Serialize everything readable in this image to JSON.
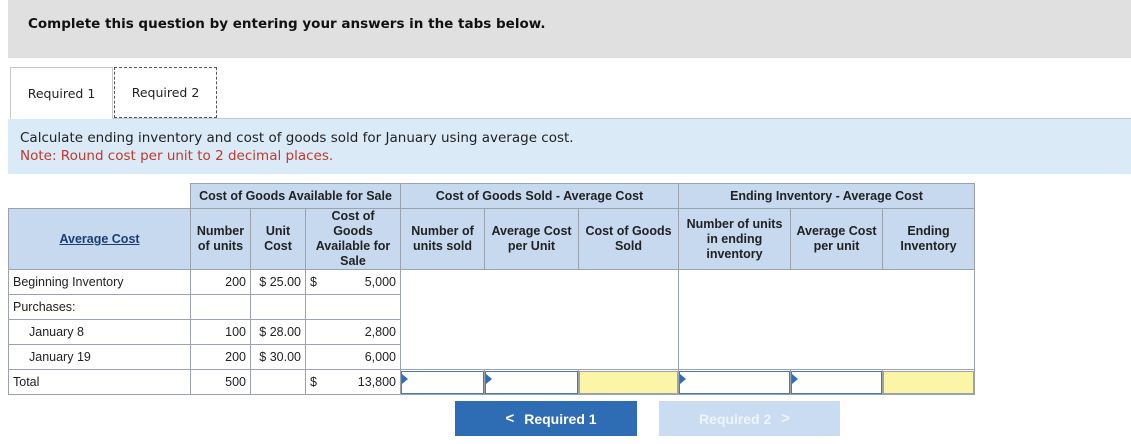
{
  "header": {
    "title": "Complete this question by entering your answers in the tabs below."
  },
  "tabs": [
    {
      "label": "Required 1"
    },
    {
      "label": "Required 2"
    }
  ],
  "instructions": {
    "line1": "Calculate ending inventory and cost of goods sold for January using average cost.",
    "line2": "Note: Round cost per unit to 2 decimal places."
  },
  "table": {
    "group_headers": {
      "available": "Cost of Goods Available for Sale",
      "sold": "Cost of Goods Sold - Average Cost",
      "ending": "Ending Inventory - Average Cost"
    },
    "corner": "Average Cost",
    "sub_headers": {
      "units": "Number of units",
      "unit_cost": "Unit Cost",
      "cogas": "Cost of Goods Available for Sale",
      "units_sold": "Number of units sold",
      "avg_cost_sold": "Average Cost per Unit",
      "cogs": "Cost of Goods Sold",
      "units_ending": "Number of units in ending inventory",
      "avg_cost_ending": "Average Cost per unit",
      "ending_inventory": "Ending Inventory"
    },
    "rows": [
      {
        "label": "Beginning Inventory",
        "units": "200",
        "unit_cost": "$ 25.00",
        "dollar": "$",
        "total": "5,000"
      },
      {
        "label": "Purchases:",
        "units": "",
        "unit_cost": "",
        "dollar": "",
        "total": ""
      },
      {
        "label": "January 8",
        "units": "100",
        "unit_cost": "$ 28.00",
        "dollar": "",
        "total": "2,800"
      },
      {
        "label": "January 19",
        "units": "200",
        "unit_cost": "$ 30.00",
        "dollar": "",
        "total": "6,000"
      },
      {
        "label": "Total",
        "units": "500",
        "unit_cost": "",
        "dollar": "$",
        "total": "13,800"
      }
    ]
  },
  "nav": {
    "prev_label": "Required 1",
    "next_label": "Required 2",
    "prev_chevron": "<",
    "next_chevron": ">"
  },
  "colors": {
    "header_bg": "#e0e0e0",
    "instructions_bg": "#dbeaf7",
    "note_red": "#c0392b",
    "table_header_bg": "#c6d9ef",
    "answer_yellow": "#fbf5a8",
    "button_blue": "#2e6db4",
    "button_disabled": "#c9dcf1"
  }
}
